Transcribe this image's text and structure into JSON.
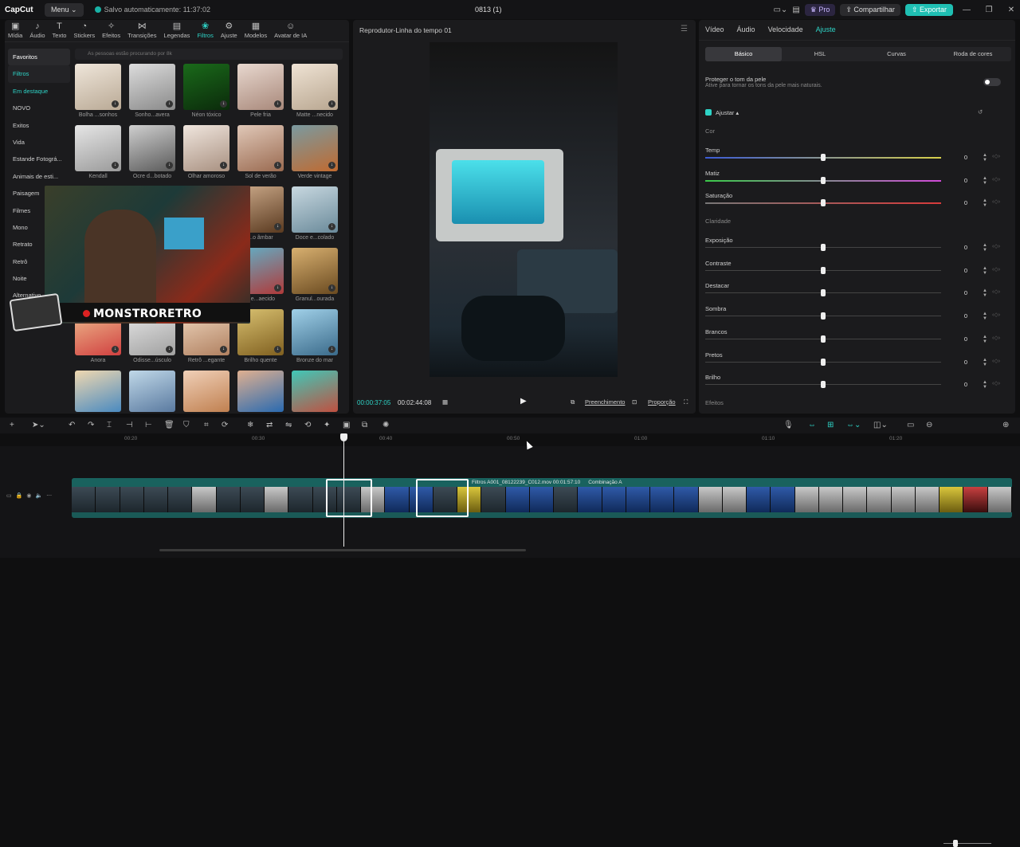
{
  "titlebar": {
    "logo": "CapCut",
    "menu_label": "Menu",
    "autosave": "Salvo automaticamente: 11:37:02",
    "project_name": "0813 (1)",
    "pro_label": "Pro",
    "share_label": "Compartilhar",
    "export_label": "Exportar"
  },
  "top_tabs": [
    {
      "label": "Mídia",
      "icon": "media-icon"
    },
    {
      "label": "Áudio",
      "icon": "audio-icon"
    },
    {
      "label": "Texto",
      "icon": "text-icon"
    },
    {
      "label": "Stickers",
      "icon": "sticker-icon"
    },
    {
      "label": "Efeitos",
      "icon": "effects-icon"
    },
    {
      "label": "Transições",
      "icon": "transitions-icon"
    },
    {
      "label": "Legendas",
      "icon": "captions-icon"
    },
    {
      "label": "Filtros",
      "icon": "filters-icon"
    },
    {
      "label": "Ajuste",
      "icon": "adjust-icon"
    },
    {
      "label": "Modelos",
      "icon": "templates-icon"
    },
    {
      "label": "Avatar de IA",
      "icon": "avatar-icon"
    }
  ],
  "sidebar": [
    {
      "label": "Favoritos"
    },
    {
      "label": "Filtros"
    },
    {
      "label": "Em destaque"
    },
    {
      "label": "NOVO"
    },
    {
      "label": "Exitos"
    },
    {
      "label": "Vida"
    },
    {
      "label": "Estande Fotográ..."
    },
    {
      "label": "Animais de esti..."
    },
    {
      "label": "Paisagem"
    },
    {
      "label": "Filmes"
    },
    {
      "label": "Mono"
    },
    {
      "label": "Retrato"
    },
    {
      "label": "Retrô"
    },
    {
      "label": "Noite"
    },
    {
      "label": "Alternativo"
    }
  ],
  "search_placeholder": "As pessoas estão procurando por 8k",
  "filters": [
    {
      "label": "Bolha ...sonhos"
    },
    {
      "label": "Sonho...avera"
    },
    {
      "label": "Néon tóxico"
    },
    {
      "label": "Pele fria"
    },
    {
      "label": "Matte ...necido"
    },
    {
      "label": "Kendall"
    },
    {
      "label": "Ocre d...botado"
    },
    {
      "label": "Olhar amoroso"
    },
    {
      "label": "Sol de verão"
    },
    {
      "label": "Verde vintage"
    },
    {
      "label": "...o âmbar"
    },
    {
      "label": "Doce e...colado"
    },
    {
      "label": "...e...aecido"
    },
    {
      "label": "Granul...ourada"
    },
    {
      "label": "Anora"
    },
    {
      "label": "Odisse...úsculo"
    },
    {
      "label": "Retrô ...egante"
    },
    {
      "label": "Brilho quente"
    },
    {
      "label": "Bronze do mar"
    }
  ],
  "overlay": {
    "brand": "MONSTRORETRO"
  },
  "player": {
    "title": "Reprodutor-Linha do tempo 01",
    "current_time": "00:00:37:05",
    "total_time": "00:02:44:08",
    "fill_label": "Preenchimento",
    "ratio_label": "Proporção"
  },
  "right_panel": {
    "tabs": [
      "Vídeo",
      "Áudio",
      "Velocidade",
      "Ajuste"
    ],
    "subtabs": [
      "Básico",
      "HSL",
      "Curvas",
      "Roda de cores"
    ],
    "skin_title": "Proteger o tom da pele",
    "skin_desc": "Ative para tornar os tons da pele mais naturais.",
    "adjust_label": "Ajustar",
    "section_color": "Cor",
    "section_clarity": "Claridade",
    "section_effects": "Efeitos",
    "sliders_color": [
      {
        "label": "Temp",
        "value": "0"
      },
      {
        "label": "Matiz",
        "value": "0"
      },
      {
        "label": "Saturação",
        "value": "0"
      }
    ],
    "sliders_clarity": [
      {
        "label": "Exposição",
        "value": "0"
      },
      {
        "label": "Contraste",
        "value": "0"
      },
      {
        "label": "Destacar",
        "value": "0"
      },
      {
        "label": "Sombra",
        "value": "0"
      },
      {
        "label": "Brancos",
        "value": "0"
      },
      {
        "label": "Pretos",
        "value": "0"
      },
      {
        "label": "Brilho",
        "value": "0"
      }
    ]
  },
  "timeline": {
    "ruler": [
      "00:20",
      "00:30",
      "00:40",
      "00:50",
      "01:00",
      "01:10",
      "01:20"
    ],
    "clip_label_main": "Filtros  A001_08122239_C012.mov  00:01:57:10",
    "clip_label_combo": "Combinação A"
  },
  "colors": {
    "accent": "#2ed3c6",
    "panel": "#1b1b1d",
    "bg": "#0f0f10"
  }
}
